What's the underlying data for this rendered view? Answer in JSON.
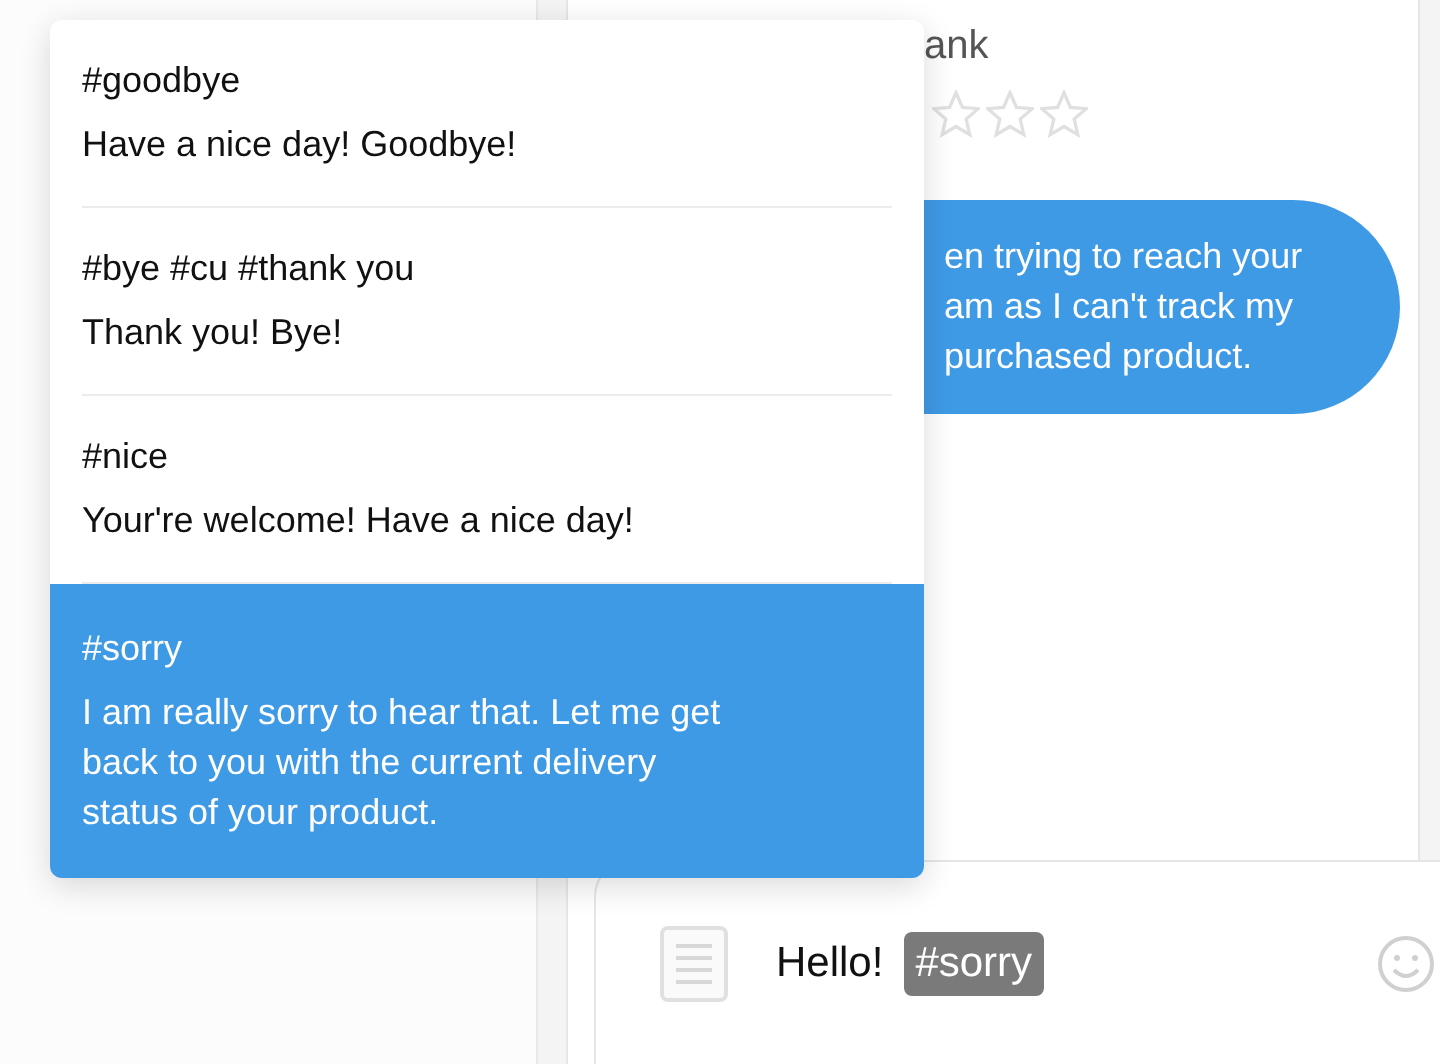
{
  "chat": {
    "header_name": "ank",
    "stars": 0,
    "message": "en trying to reach your\nam as I can't track my\npurchased product."
  },
  "suggestions": [
    {
      "tag": "#goodbye",
      "text": "Have a nice day! Goodbye!",
      "selected": false
    },
    {
      "tag": "#bye #cu #thank you",
      "text": "Thank you! Bye!",
      "selected": false
    },
    {
      "tag": "#nice",
      "text": "Your're welcome! Have a nice day!",
      "selected": false
    },
    {
      "tag": "#sorry",
      "text": "I am really sorry to hear that. Let me get back to you with the current delivery status of your product.",
      "selected": true
    }
  ],
  "composer": {
    "text": "Hello!",
    "tag": "#sorry"
  }
}
